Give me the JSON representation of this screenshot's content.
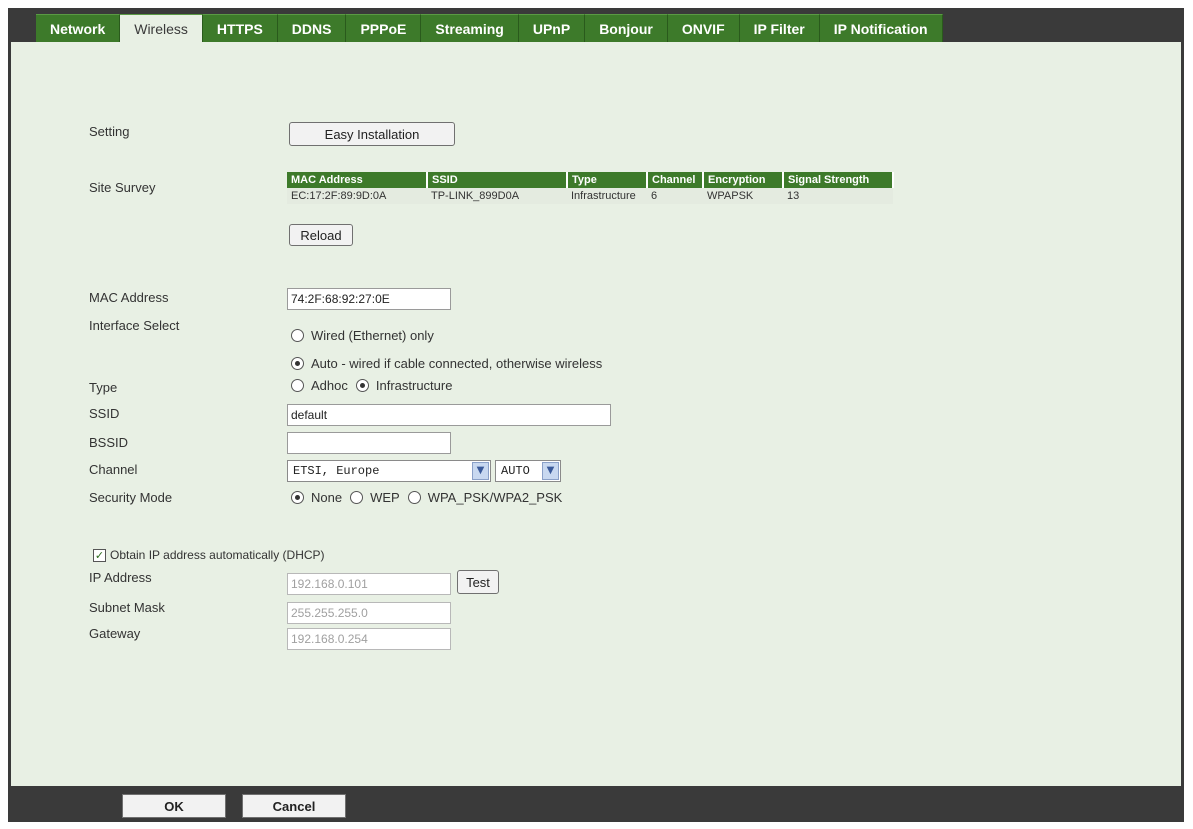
{
  "tabs": [
    "Network",
    "Wireless",
    "HTTPS",
    "DDNS",
    "PPPoE",
    "Streaming",
    "UPnP",
    "Bonjour",
    "ONVIF",
    "IP Filter",
    "IP Notification"
  ],
  "active_tab": "Wireless",
  "setting": {
    "label": "Setting",
    "easy_install_label": "Easy Installation"
  },
  "site_survey": {
    "label": "Site Survey",
    "columns": [
      "MAC Address",
      "SSID",
      "Type",
      "Channel",
      "Encryption",
      "Signal Strength"
    ],
    "rows": [
      [
        "EC:17:2F:89:9D:0A",
        "TP-LINK_899D0A",
        "Infrastructure",
        "6",
        "WPAPSK",
        "13"
      ]
    ],
    "reload_label": "Reload"
  },
  "mac_address": {
    "label": "MAC Address",
    "value": "74:2F:68:92:27:0E"
  },
  "interface_select": {
    "label": "Interface Select",
    "options": [
      "Wired (Ethernet) only",
      "Auto - wired if cable connected, otherwise wireless"
    ],
    "selected": "Auto - wired if cable connected, otherwise wireless"
  },
  "type": {
    "label": "Type",
    "options": [
      "Adhoc",
      "Infrastructure"
    ],
    "selected": "Infrastructure"
  },
  "ssid": {
    "label": "SSID",
    "value": "default"
  },
  "bssid": {
    "label": "BSSID",
    "value": ""
  },
  "channel": {
    "label": "Channel",
    "region": "ETSI, Europe",
    "channel": "AUTO"
  },
  "security_mode": {
    "label": "Security Mode",
    "options": [
      "None",
      "WEP",
      "WPA_PSK/WPA2_PSK"
    ],
    "selected": "None"
  },
  "dhcp": {
    "label": "Obtain IP address automatically (DHCP)",
    "checked": true
  },
  "ip_address": {
    "label": "IP Address",
    "value": "192.168.0.101",
    "test_label": "Test"
  },
  "subnet_mask": {
    "label": "Subnet Mask",
    "value": "255.255.255.0"
  },
  "gateway": {
    "label": "Gateway",
    "value": "192.168.0.254"
  },
  "footer": {
    "ok_label": "OK",
    "cancel_label": "Cancel"
  },
  "icons": {
    "dropdown": "chevron-down-icon",
    "checkmark": "checkmark-icon"
  },
  "colors": {
    "tab_green": "#3d7a2a",
    "content_bg": "#e8f0e4",
    "frame_dark": "#3a3a3a"
  }
}
